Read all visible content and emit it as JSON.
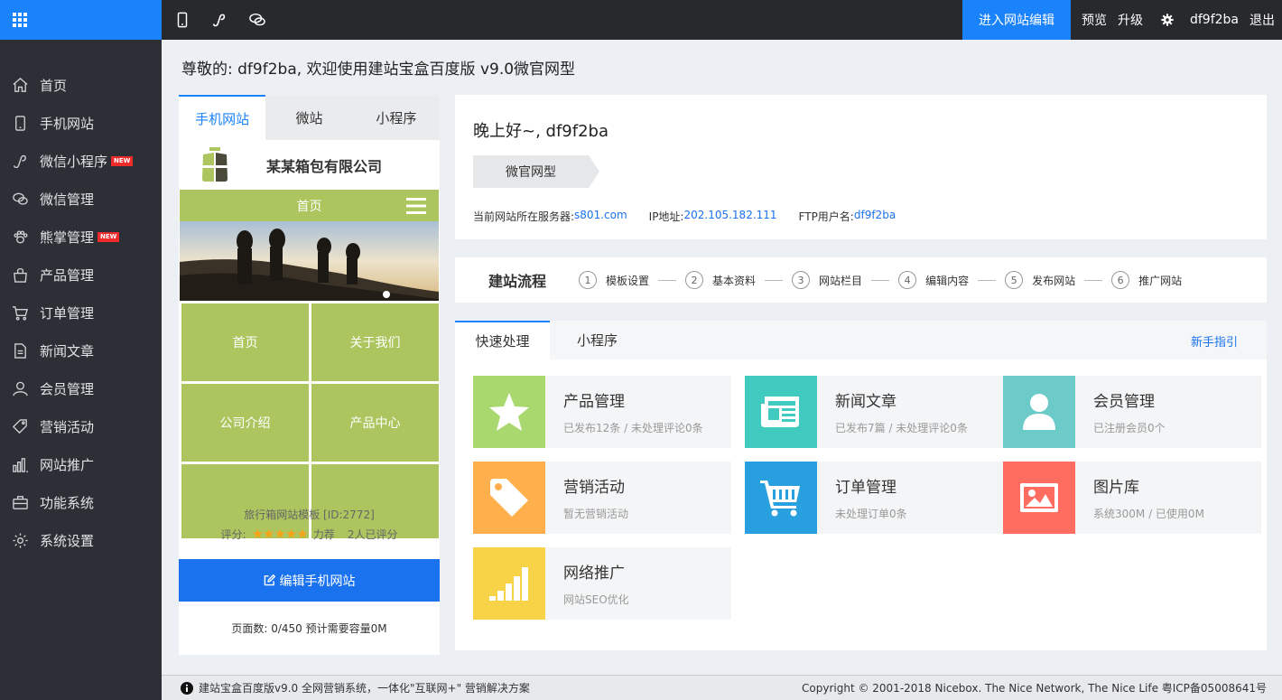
{
  "topbar": {
    "enter_editor": "进入网站编辑",
    "preview": "预览",
    "upgrade": "升级",
    "username": "df9f2ba",
    "logout": "退出",
    "icons": [
      "mobile-icon",
      "miniprogram-icon",
      "wechat-icon"
    ]
  },
  "sidebar": {
    "items": [
      {
        "label": "首页",
        "icon": "home-icon"
      },
      {
        "label": "手机网站",
        "icon": "mobile-icon"
      },
      {
        "label": "微信小程序",
        "icon": "miniprogram-icon",
        "badge": "NEW"
      },
      {
        "label": "微信管理",
        "icon": "chat-icon"
      },
      {
        "label": "熊掌管理",
        "icon": "paw-icon",
        "badge": "NEW"
      },
      {
        "label": "产品管理",
        "icon": "bag-icon"
      },
      {
        "label": "订单管理",
        "icon": "cart-icon"
      },
      {
        "label": "新闻文章",
        "icon": "document-icon"
      },
      {
        "label": "会员管理",
        "icon": "user-icon"
      },
      {
        "label": "营销活动",
        "icon": "tag-icon"
      },
      {
        "label": "网站推广",
        "icon": "bar-chart-icon"
      },
      {
        "label": "功能系统",
        "icon": "briefcase-icon"
      },
      {
        "label": "系统设置",
        "icon": "gear-icon"
      }
    ]
  },
  "welcome": "尊敬的: df9f2ba, 欢迎使用建站宝盒百度版 v9.0微官网型",
  "preview_panel": {
    "tabs": [
      "手机网站",
      "微站",
      "小程序"
    ],
    "company": "某某箱包有限公司",
    "nav_home": "首页",
    "grid": [
      "首页",
      "关于我们",
      "公司介绍",
      "产品中心",
      "",
      ""
    ],
    "template": "旅行箱网站模板 [ID:2772]",
    "rating_label": "评分:",
    "stars": "★★★★★",
    "rating_word": "力荐",
    "rating_count": "2人已评分",
    "edit_button": "编辑手机网站",
    "pages": "页面数: 0/450 预计需要容量0M"
  },
  "info": {
    "greeting": "晚上好~, df9f2ba",
    "badge": "微官网型",
    "server_label": "当前网站所在服务器:",
    "server": "s801.com",
    "ip_label": "IP地址:",
    "ip": "202.105.182.111",
    "ftp_label": "FTP用户名:",
    "ftp": "df9f2ba"
  },
  "steps": {
    "title": "建站流程",
    "items": [
      {
        "num": "1",
        "label": "模板设置"
      },
      {
        "num": "2",
        "label": "基本资料"
      },
      {
        "num": "3",
        "label": "网站栏目"
      },
      {
        "num": "4",
        "label": "编辑内容"
      },
      {
        "num": "5",
        "label": "发布网站"
      },
      {
        "num": "6",
        "label": "推广网站"
      }
    ]
  },
  "quick": {
    "tabs": [
      "快速处理",
      "小程序"
    ],
    "guide": "新手指引",
    "tiles": [
      {
        "title": "产品管理",
        "sub": "已发布12条 / 未处理评论0条",
        "color": "#a9d86e",
        "icon": "star-icon"
      },
      {
        "title": "新闻文章",
        "sub": "已发布7篇 / 未处理评论0条",
        "color": "#41cac0",
        "icon": "newspaper-icon"
      },
      {
        "title": "会员管理",
        "sub": "已注册会员0个",
        "color": "#6ccac9",
        "icon": "user-icon"
      },
      {
        "title": "营销活动",
        "sub": "暂无营销活动",
        "color": "#ffb04c",
        "icon": "tag-icon"
      },
      {
        "title": "订单管理",
        "sub": "未处理订单0条",
        "color": "#28a0e0",
        "icon": "cart-icon"
      },
      {
        "title": "图片库",
        "sub": "系统300M / 已使用0M",
        "color": "#ff6c60",
        "icon": "image-icon"
      },
      {
        "title": "网络推广",
        "sub": "网站SEO优化",
        "color": "#f8d347",
        "icon": "signal-icon"
      }
    ]
  },
  "footer": {
    "left": "建站宝盒百度版v9.0 全网营销系统，一体化\"互联网+\" 营销解决方案",
    "right": "Copyright © 2001-2018 Nicebox. The Nice Network, The Nice Life 粤ICP备05008641号"
  }
}
